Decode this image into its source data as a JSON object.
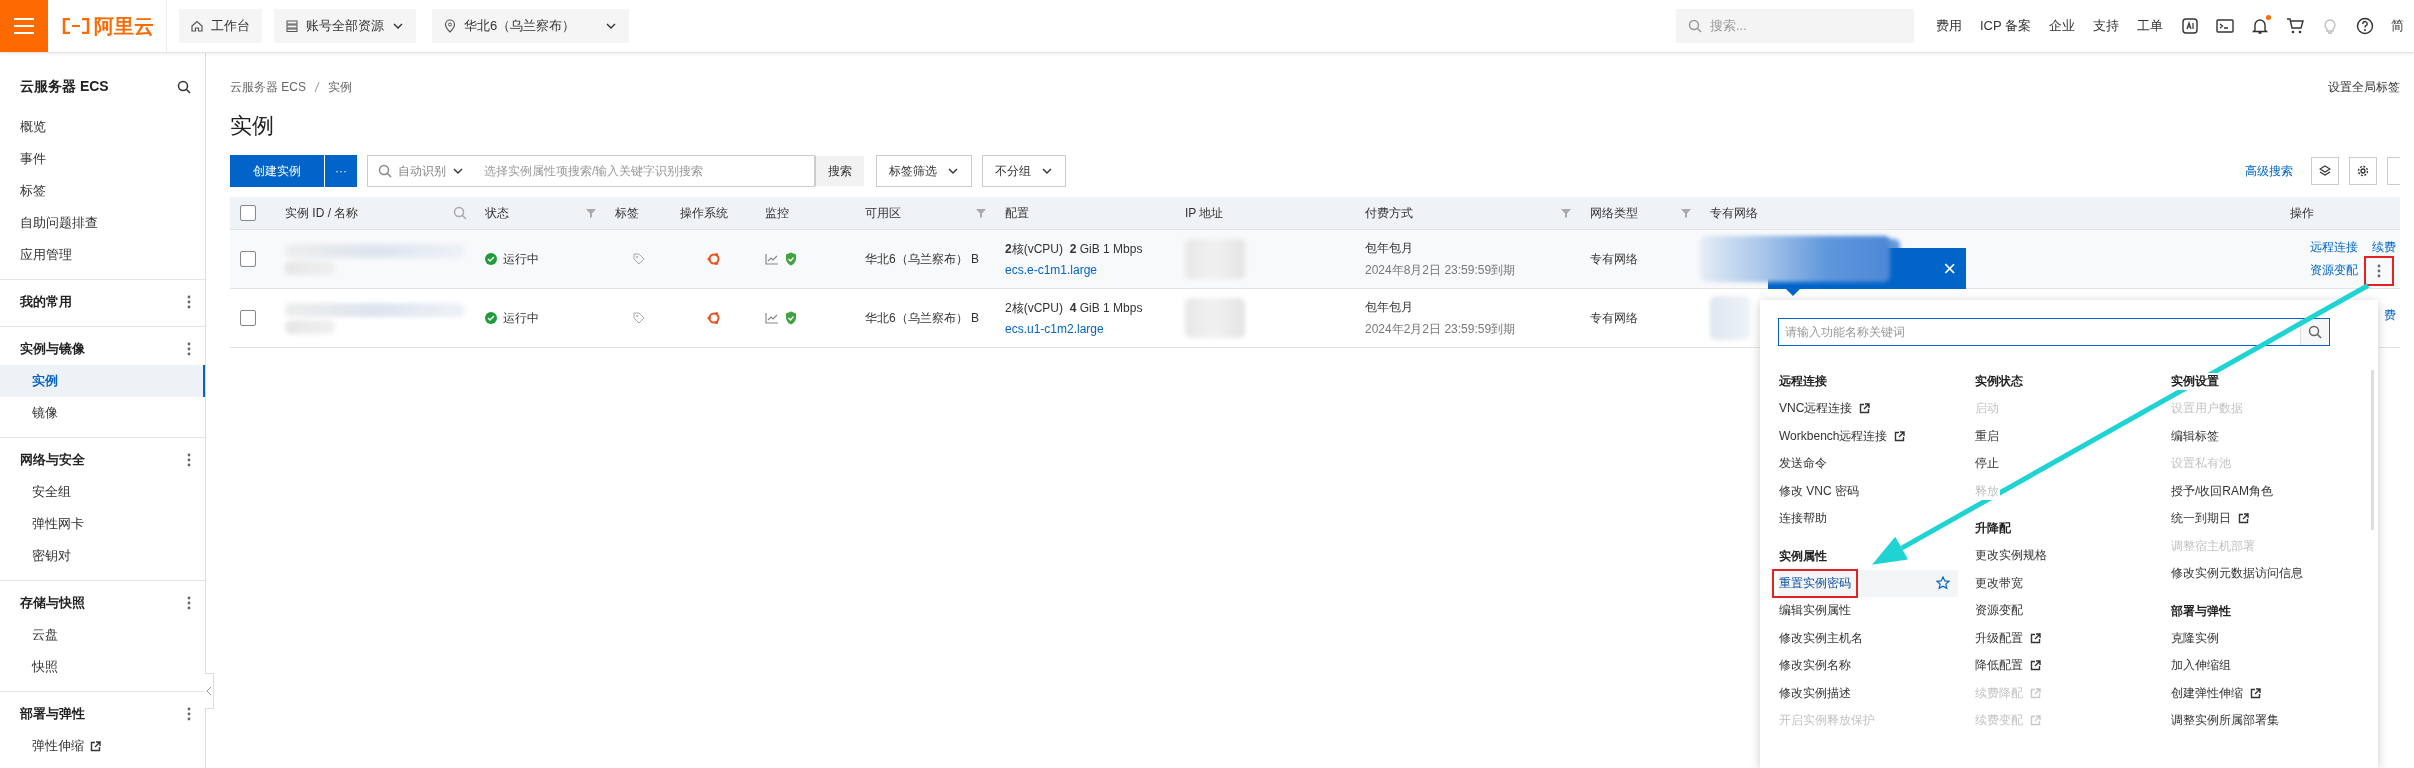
{
  "topbar": {
    "logo": "阿里云",
    "workbench": "工作台",
    "resources": "账号全部资源",
    "region": "华北6（乌兰察布）",
    "search_placeholder": "搜索...",
    "links": [
      "费用",
      "ICP 备案",
      "企业",
      "支持",
      "工单"
    ],
    "notification_dot": true,
    "language": "简"
  },
  "sidebar": {
    "title": "云服务器 ECS",
    "items": [
      {
        "label": "概览",
        "selected": false
      },
      {
        "label": "事件",
        "selected": false
      },
      {
        "label": "标签",
        "selected": false
      },
      {
        "label": "自助问题排查",
        "selected": false
      },
      {
        "label": "应用管理",
        "selected": false
      }
    ],
    "sections": [
      {
        "label": "我的常用"
      },
      {
        "label": "实例与镜像",
        "children": [
          {
            "label": "实例",
            "selected": true,
            "external": false
          },
          {
            "label": "镜像",
            "selected": false,
            "external": false
          }
        ]
      },
      {
        "label": "网络与安全",
        "children": [
          {
            "label": "安全组",
            "selected": false,
            "external": false
          },
          {
            "label": "弹性网卡",
            "selected": false,
            "external": false
          },
          {
            "label": "密钥对",
            "selected": false,
            "external": false
          }
        ]
      },
      {
        "label": "存储与快照",
        "children": [
          {
            "label": "云盘",
            "selected": false,
            "external": false
          },
          {
            "label": "快照",
            "selected": false,
            "external": false
          }
        ]
      },
      {
        "label": "部署与弹性",
        "children": [
          {
            "label": "弹性伸缩",
            "selected": false,
            "external": true
          }
        ]
      }
    ]
  },
  "content": {
    "breadcrumb": [
      "云服务器 ECS",
      "实例"
    ],
    "title": "实例",
    "global_tags": "设置全局标签",
    "toolbar": {
      "create": "创建实例",
      "more": "···",
      "search_mode": "自动识别",
      "search_placeholder": "选择实例属性项搜索/输入关键字识别搜索",
      "search_button": "搜索",
      "filters": [
        "标签筛选",
        "不分组"
      ],
      "advanced": "高级搜索"
    },
    "table": {
      "select_all": {
        "checked": false
      },
      "columns": [
        {
          "label": "实例 ID / 名称",
          "searchable": true,
          "filterable": false
        },
        {
          "label": "状态",
          "searchable": false,
          "filterable": true
        },
        {
          "label": "标签",
          "searchable": false,
          "filterable": false
        },
        {
          "label": "操作系统",
          "searchable": false,
          "filterable": false
        },
        {
          "label": "监控",
          "searchable": false,
          "filterable": false
        },
        {
          "label": "可用区",
          "searchable": false,
          "filterable": true
        },
        {
          "label": "配置",
          "searchable": false,
          "filterable": false
        },
        {
          "label": "IP 地址",
          "searchable": false,
          "filterable": false
        },
        {
          "label": "付费方式",
          "searchable": false,
          "filterable": true
        },
        {
          "label": "网络类型",
          "searchable": false,
          "filterable": true
        },
        {
          "label": "专有网络",
          "searchable": false,
          "filterable": false
        },
        {
          "label": "操作",
          "searchable": false,
          "filterable": false
        }
      ],
      "rows": [
        {
          "checked": false,
          "status": "运行中",
          "zone": "华北6（乌兰察布） B",
          "config": "**2**核(vCPU)  **2** GiB 1 Mbps",
          "spec": "ecs.e-c1m1.large",
          "billing": "包年包月",
          "expiry": "2024年8月2日 23:59:59到期",
          "network_type": "专有网络",
          "actions": {
            "connect": "远程连接",
            "renew": "续费",
            "resize": "资源变配",
            "more": {
              "menu_open": true
            }
          }
        },
        {
          "checked": false,
          "status": "运行中",
          "zone": "华北6（乌兰察布） B",
          "config": "2核(vCPU)  **4** GiB 1 Mbps",
          "spec": "ecs.u1-c1m2.large",
          "billing": "包年包月",
          "expiry": "2024年2月2日 23:59:59到期",
          "network_type": "专有网络",
          "actions": {
            "renew": "费"
          }
        }
      ]
    }
  },
  "tooltip": {
    "close": "×"
  },
  "action_menu": {
    "search_placeholder": "请输入功能名称关键词",
    "columns": [
      [
        {
          "title": "远程连接",
          "items": [
            {
              "label": "VNC远程连接",
              "disabled": false,
              "external": true,
              "hovered": false
            },
            {
              "label": "Workbench远程连接",
              "disabled": false,
              "external": true,
              "hovered": false
            },
            {
              "label": "发送命令",
              "disabled": false,
              "external": false,
              "hovered": false
            },
            {
              "label": "修改 VNC 密码",
              "disabled": false,
              "external": false,
              "hovered": false
            },
            {
              "label": "连接帮助",
              "disabled": false,
              "external": false,
              "hovered": false
            }
          ]
        },
        {
          "title": "实例属性",
          "items": [
            {
              "label": "重置实例密码",
              "disabled": false,
              "external": false,
              "hovered": true
            },
            {
              "label": "编辑实例属性",
              "disabled": false,
              "external": false,
              "hovered": false
            },
            {
              "label": "修改实例主机名",
              "disabled": false,
              "external": false,
              "hovered": false
            },
            {
              "label": "修改实例名称",
              "disabled": false,
              "external": false,
              "hovered": false
            },
            {
              "label": "修改实例描述",
              "disabled": false,
              "external": false,
              "hovered": false
            },
            {
              "label": "开启实例释放保护",
              "disabled": true,
              "external": false,
              "hovered": false
            }
          ]
        }
      ],
      [
        {
          "title": "实例状态",
          "items": [
            {
              "label": "启动",
              "disabled": true,
              "external": false,
              "hovered": false
            },
            {
              "label": "重启",
              "disabled": false,
              "external": false,
              "hovered": false
            },
            {
              "label": "停止",
              "disabled": false,
              "external": false,
              "hovered": false
            },
            {
              "label": "释放",
              "disabled": true,
              "external": false,
              "hovered": false
            }
          ]
        },
        {
          "title": "升降配",
          "items": [
            {
              "label": "更改实例规格",
              "disabled": false,
              "external": false,
              "hovered": false
            },
            {
              "label": "更改带宽",
              "disabled": false,
              "external": false,
              "hovered": false
            },
            {
              "label": "资源变配",
              "disabled": false,
              "external": false,
              "hovered": false
            },
            {
              "label": "升级配置",
              "disabled": false,
              "external": true,
              "hovered": false
            },
            {
              "label": "降低配置",
              "disabled": false,
              "external": true,
              "hovered": false
            },
            {
              "label": "续费降配",
              "disabled": true,
              "external": true,
              "hovered": false
            },
            {
              "label": "续费变配",
              "disabled": true,
              "external": true,
              "hovered": false
            }
          ]
        }
      ],
      [
        {
          "title": "实例设置",
          "items": [
            {
              "label": "设置用户数据",
              "disabled": true,
              "external": false,
              "hovered": false
            },
            {
              "label": "编辑标签",
              "disabled": false,
              "external": false,
              "hovered": false
            },
            {
              "label": "设置私有池",
              "disabled": true,
              "external": false,
              "hovered": false
            },
            {
              "label": "授予/收回RAM角色",
              "disabled": false,
              "external": false,
              "hovered": false
            },
            {
              "label": "统一到期日",
              "disabled": false,
              "external": true,
              "hovered": false
            },
            {
              "label": "调整宿主机部署",
              "disabled": true,
              "external": false,
              "hovered": false
            },
            {
              "label": "修改实例元数据访问信息",
              "disabled": false,
              "external": false,
              "hovered": false
            }
          ]
        },
        {
          "title": "部署与弹性",
          "items": [
            {
              "label": "克隆实例",
              "disabled": false,
              "external": false,
              "hovered": false
            },
            {
              "label": "加入伸缩组",
              "disabled": false,
              "external": false,
              "hovered": false
            },
            {
              "label": "创建弹性伸缩",
              "disabled": false,
              "external": true,
              "hovered": false
            },
            {
              "label": "调整实例所属部署集",
              "disabled": false,
              "external": false,
              "hovered": false
            }
          ]
        }
      ]
    ]
  }
}
